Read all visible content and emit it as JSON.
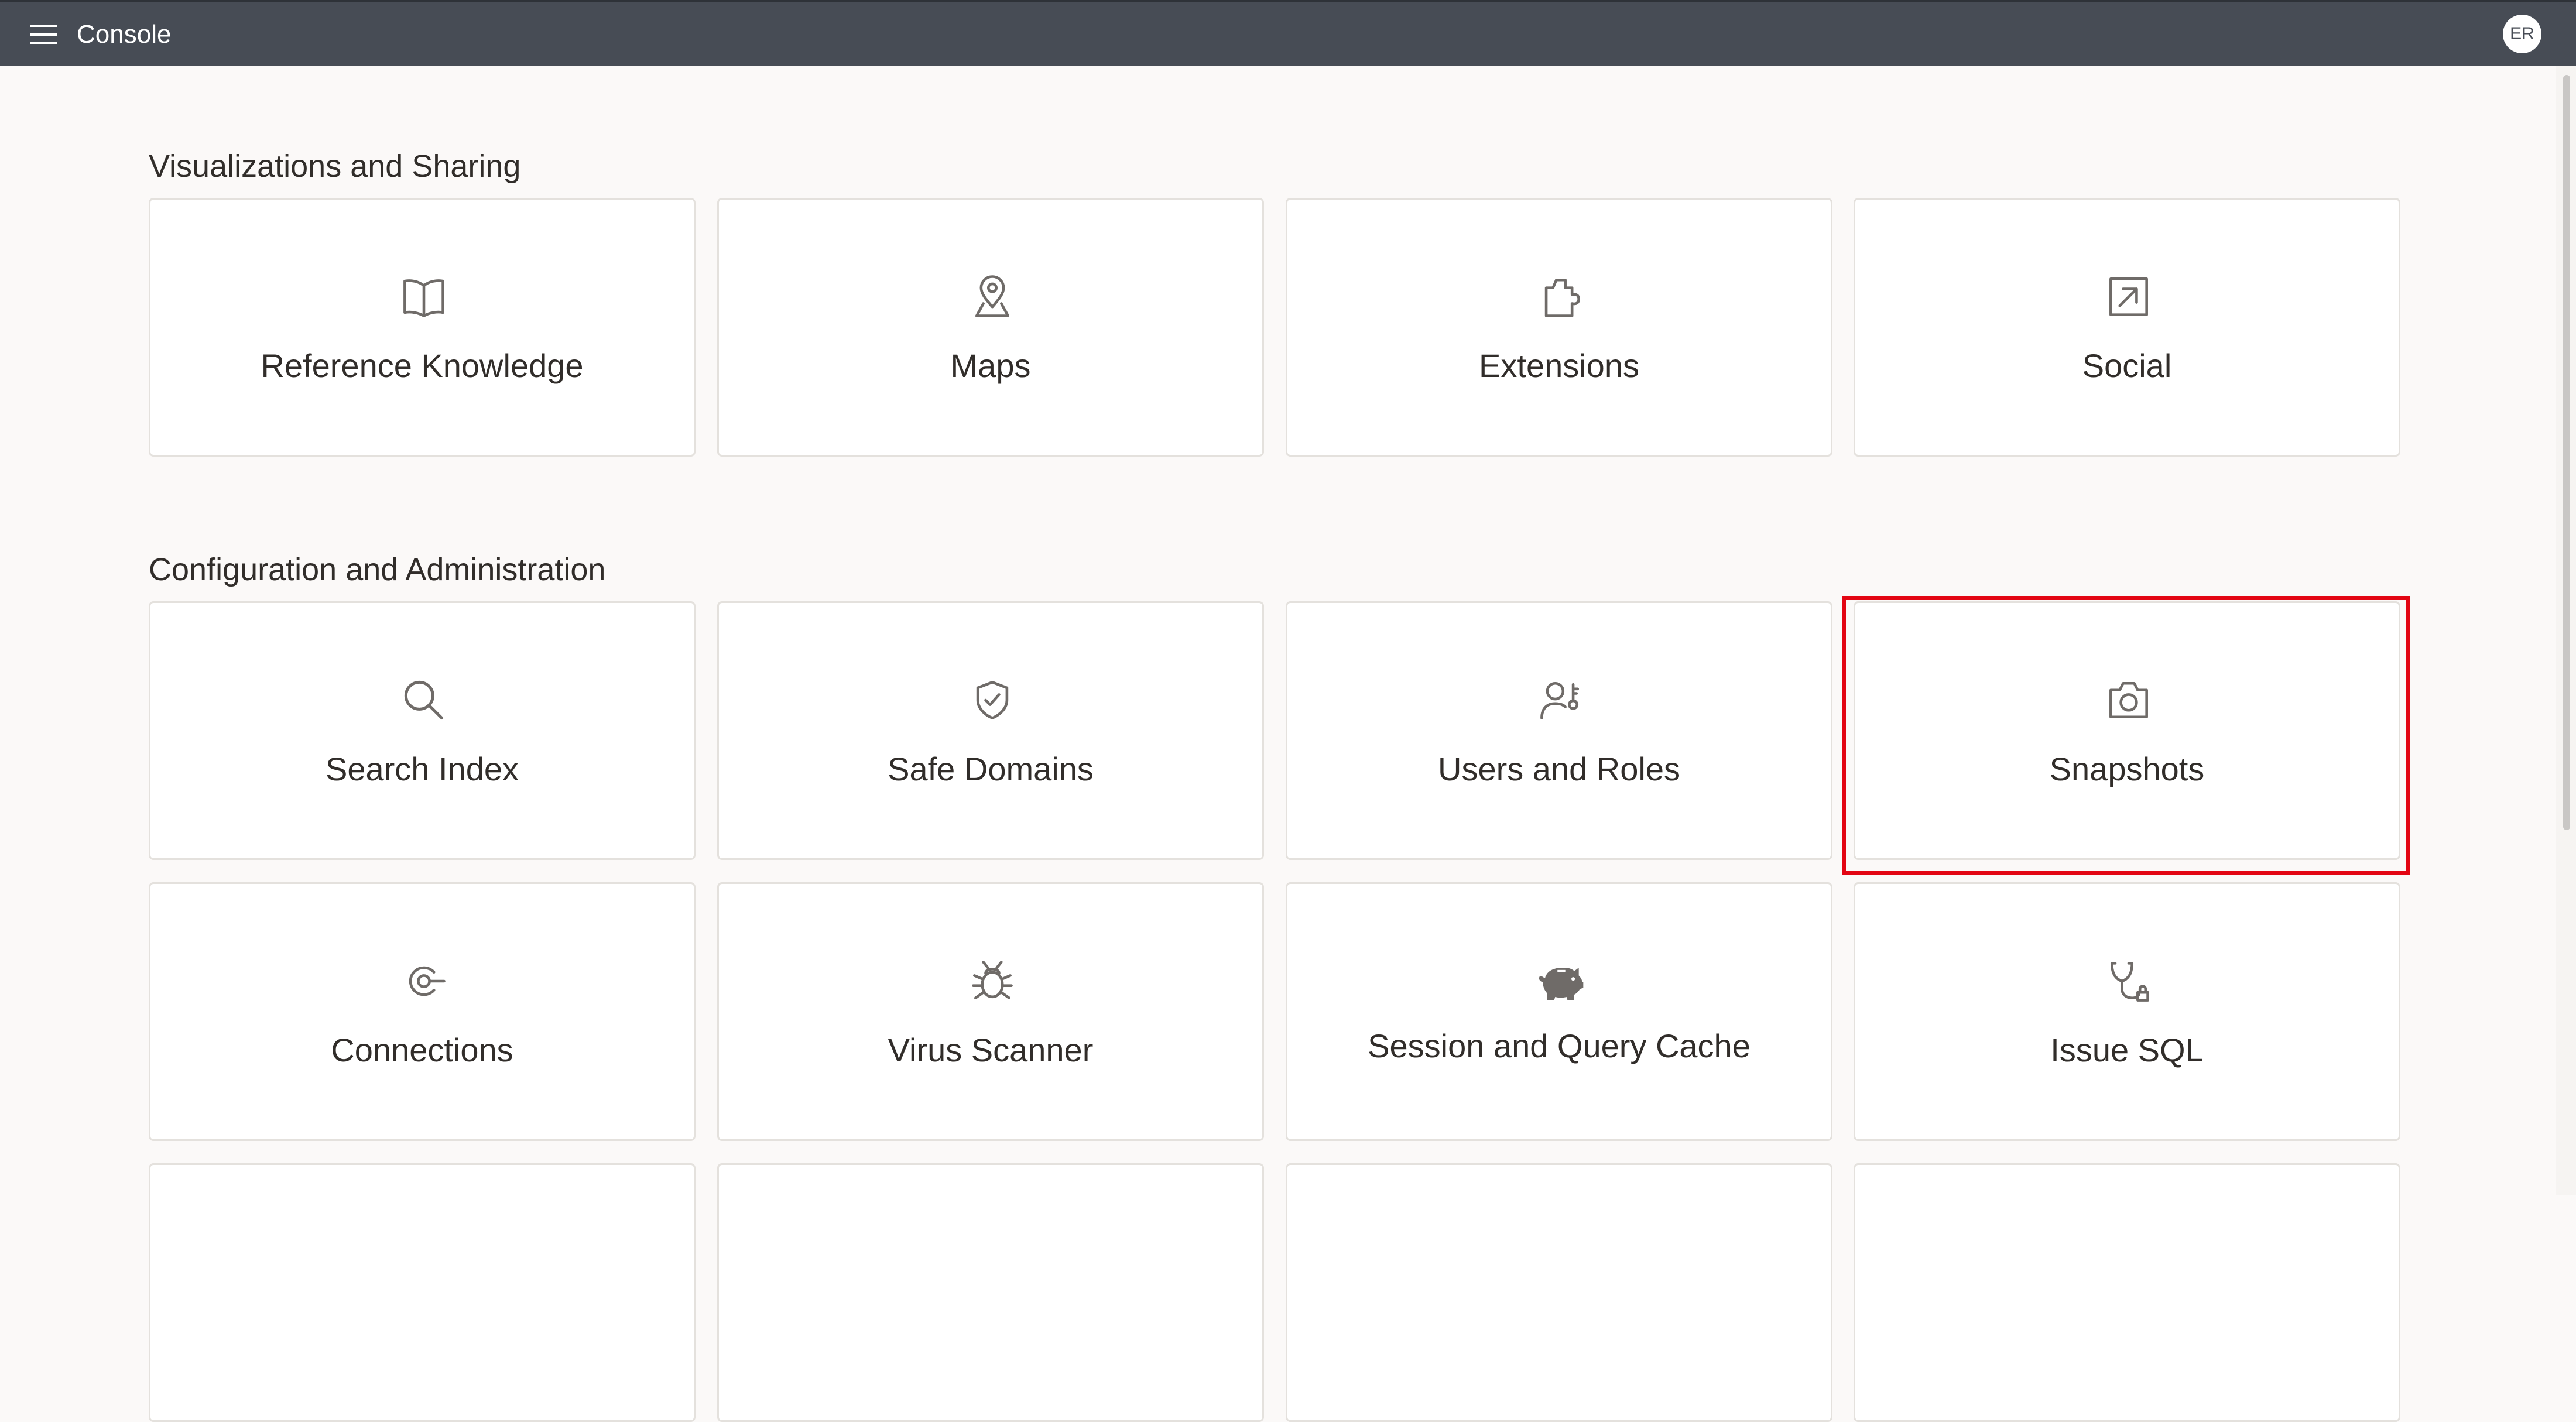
{
  "header": {
    "title": "Console",
    "avatar_initials": "ER",
    "menu_icon": "hamburger-menu-icon",
    "background_color": "#474c55"
  },
  "sections": [
    {
      "title": "Visualizations and Sharing",
      "tiles": [
        {
          "label": "Reference Knowledge",
          "icon": "book-icon"
        },
        {
          "label": "Maps",
          "icon": "map-pin-icon"
        },
        {
          "label": "Extensions",
          "icon": "puzzle-piece-icon"
        },
        {
          "label": "Social",
          "icon": "share-arrow-icon"
        }
      ]
    },
    {
      "title": "Configuration and Administration",
      "tiles": [
        {
          "label": "Search Index",
          "icon": "search-icon"
        },
        {
          "label": "Safe Domains",
          "icon": "shield-check-icon"
        },
        {
          "label": "Users and Roles",
          "icon": "user-key-icon"
        },
        {
          "label": "Snapshots",
          "icon": "camera-icon"
        },
        {
          "label": "Connections",
          "icon": "connection-icon"
        },
        {
          "label": "Virus Scanner",
          "icon": "bug-icon"
        },
        {
          "label": "Session and Query Cache",
          "icon": "piggy-bank-icon"
        },
        {
          "label": "Issue SQL",
          "icon": "stethoscope-icon"
        }
      ]
    }
  ],
  "highlighted_tile": "Snapshots",
  "highlight_color": "#e30613"
}
